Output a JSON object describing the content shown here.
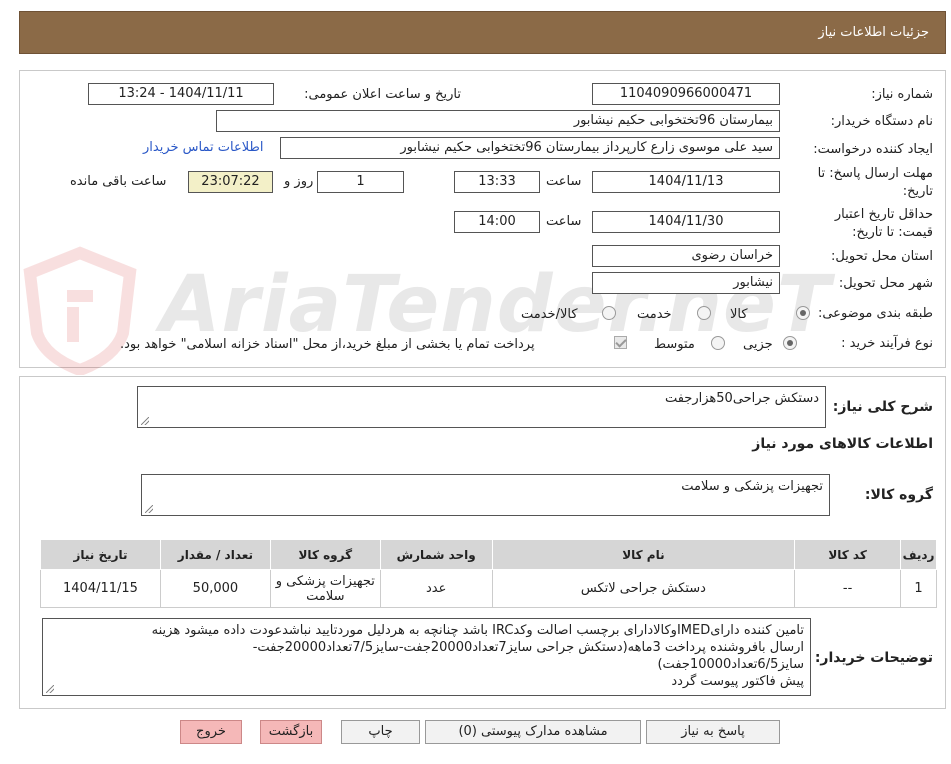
{
  "header": {
    "title": "جزئیات اطلاعات نیاز"
  },
  "form": {
    "need_number_label": "شماره نیاز:",
    "need_number": "1104090966000471",
    "announce_label": "تاریخ و ساعت اعلان عمومی:",
    "announce_value": "1404/11/11 - 13:24",
    "buyer_org_label": "نام دستگاه خریدار:",
    "buyer_org": "بیمارستان 96تختخوابی حکیم نیشابور",
    "creator_label": "ایجاد کننده درخواست:",
    "creator": "سید علی  موسوی زارع کارپرداز بیمارستان 96تختخوابی حکیم نیشابور",
    "contact_link": "اطلاعات تماس خریدار",
    "reply_deadline_label_1": "مهلت ارسال پاسخ: تا",
    "reply_deadline_label_2": "تاریخ:",
    "reply_date": "1404/11/13",
    "time_label": "ساعت",
    "reply_time": "13:33",
    "days_value": "1",
    "days_label": "روز و",
    "remaining_time": "23:07:22",
    "remaining_label": "ساعت باقی مانده",
    "validity_label_1": "حداقل تاریخ اعتبار",
    "validity_label_2": "قیمت: تا تاریخ:",
    "validity_date": "1404/11/30",
    "validity_time": "14:00",
    "province_label": "استان محل تحویل:",
    "province": "خراسان رضوی",
    "city_label": "شهر محل تحویل:",
    "city": "نیشابور",
    "category_label": "طبقه بندی موضوعی:",
    "category_options": [
      "کالا",
      "خدمت",
      "کالا/خدمت"
    ],
    "category_selected": "کالا",
    "process_label": "نوع فرآیند خرید :",
    "process_options": [
      "جزیی",
      "متوسط"
    ],
    "process_selected": "جزیی",
    "payment_note": "پرداخت تمام یا بخشی از مبلغ خرید،از محل \"اسناد خزانه اسلامی\" خواهد بود."
  },
  "details": {
    "summary_label": "شرح کلی نیاز:",
    "summary": "دستکش جراحی50هزارجفت",
    "goods_info_title": "اطلاعات کالاهای مورد نیاز",
    "goods_group_label": "گروه کالا:",
    "goods_group": "تجهیزات پزشکی و سلامت"
  },
  "table": {
    "headers": [
      "ردیف",
      "کد کالا",
      "نام کالا",
      "واحد شمارش",
      "گروه کالا",
      "تعداد / مقدار",
      "تاریخ نیاز"
    ],
    "rows": [
      {
        "row": "1",
        "code": "--",
        "name": "دستکش جراحی لاتکس",
        "unit": "عدد",
        "group": "تجهیزات پزشکی و سلامت",
        "qty": "50,000",
        "date": "1404/11/15"
      }
    ]
  },
  "buyer_notes": {
    "label": "توضیحات خریدار:",
    "lines": [
      "تامین کننده دارایIMEDوکالادارای برچسب اصالت وکدIRC باشد چنانچه به هردلیل موردتایید نباشدعودت داده میشود هزینه",
      "ارسال بافروشنده پرداخت 3ماهه(دستکش جراحی سایز7تعداد20000جفت-سایز7/5تعداد20000جفت-",
      "سایز6/5تعداد10000جفت)",
      "پیش فاکتور پیوست گردد"
    ]
  },
  "buttons": {
    "reply": "پاسخ به نیاز",
    "attachments": "مشاهده مدارک پیوستی (0)",
    "print": "چاپ",
    "back": "بازگشت",
    "exit": "خروج"
  },
  "watermark": {
    "text": "AriaTender.neT"
  },
  "colors": {
    "header_bg": "#8b6a47",
    "link": "#2a58c7",
    "highlight": "#f3f0c8",
    "danger_button": "#f5b8b8"
  }
}
